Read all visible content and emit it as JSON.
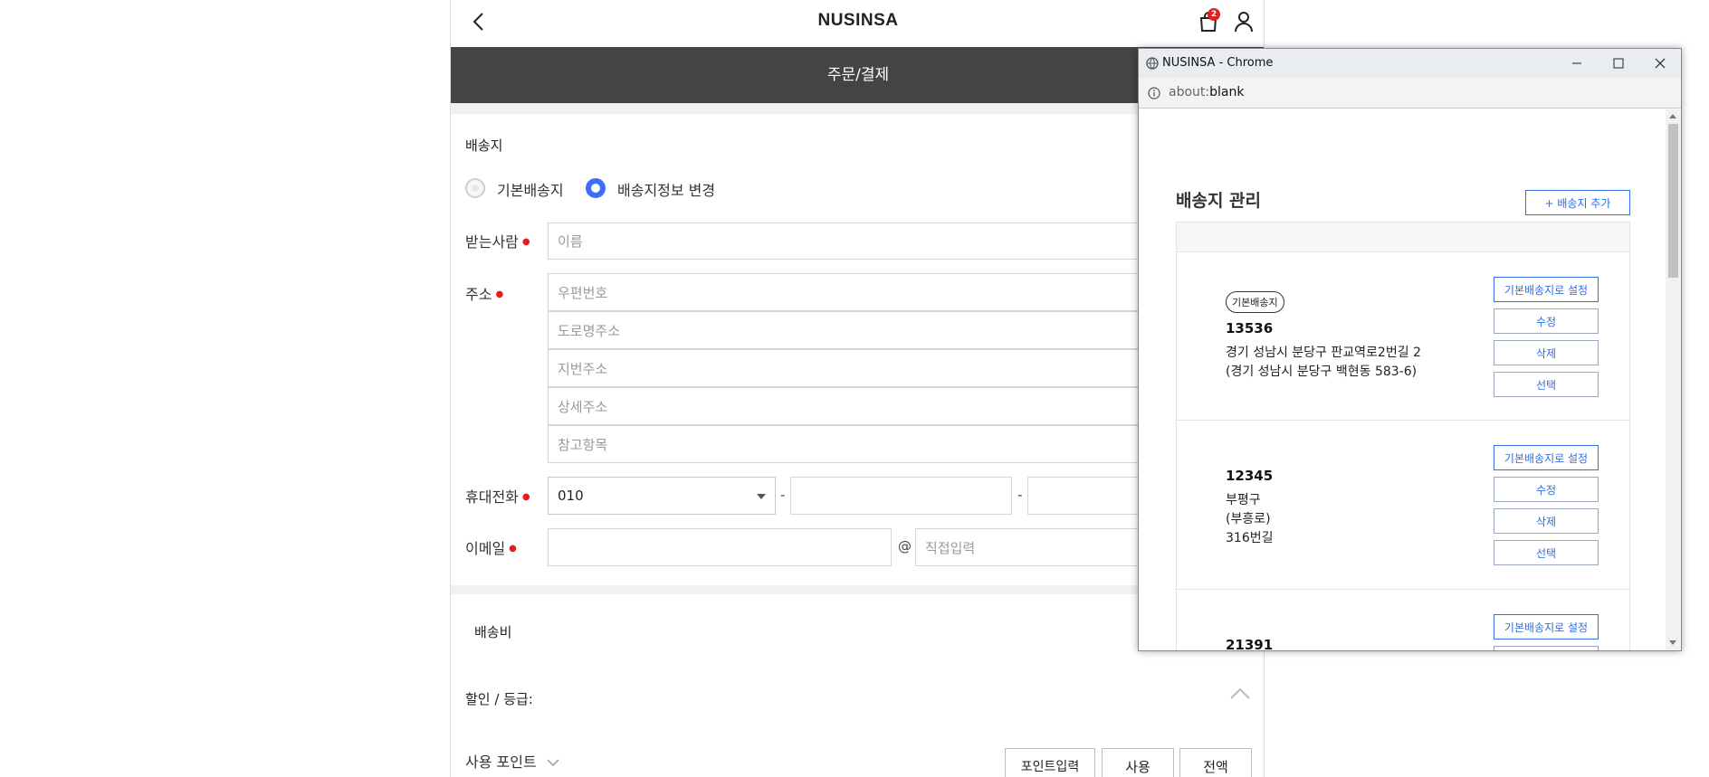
{
  "header": {
    "brand": "NUSINSA",
    "cart_count": "2"
  },
  "order_bar": {
    "title": "주문/결제"
  },
  "shipping": {
    "section_title": "배송지",
    "options": [
      {
        "label": "기본배송지",
        "selected": false
      },
      {
        "label": "배송지정보 변경",
        "selected": true
      }
    ],
    "recipient_label": "받는사람",
    "recipient_placeholder": "이름",
    "address_label": "주소",
    "address_fields": [
      "우편번호",
      "도로명주소",
      "지번주소",
      "상세주소",
      "참고항목"
    ],
    "phone_label": "휴대전화",
    "phone_prefix": "010",
    "phone_sep": "-",
    "email_label": "이메일",
    "email_at": "@",
    "email_domain_placeholder": "직접입력"
  },
  "delivery_fee": {
    "label": "배송비"
  },
  "discount": {
    "label": "할인 / 등급:"
  },
  "points": {
    "label": "사용 포인트",
    "input_btn": "포인트입력",
    "use_btn": "사용",
    "all_btn": "전액"
  },
  "popup": {
    "window_title": "NUSINSA - Chrome",
    "url_scheme": "about:",
    "url_rest": "blank",
    "heading": "배송지 관리",
    "add_button": "+ 배송지 추가",
    "addresses": [
      {
        "badge": "기본배송지",
        "zip": "13536",
        "lines": [
          "경기 성남시 분당구 판교역로2번길 2",
          "(경기 성남시 분당구 백현동 583-6)"
        ]
      },
      {
        "badge": "",
        "zip": "12345",
        "lines": [
          "부평구",
          "(부흥로)",
          "316번길"
        ]
      },
      {
        "badge": "",
        "zip": "21391",
        "lines": []
      }
    ],
    "card_buttons": {
      "set_default": "기본배송지로 설정",
      "edit": "수정",
      "delete": "삭제",
      "select": "선택"
    }
  },
  "colors": {
    "accent": "#3b6ff5",
    "header_bg": "#444444",
    "required": "#e02020",
    "link_blue": "#2f6de8"
  }
}
